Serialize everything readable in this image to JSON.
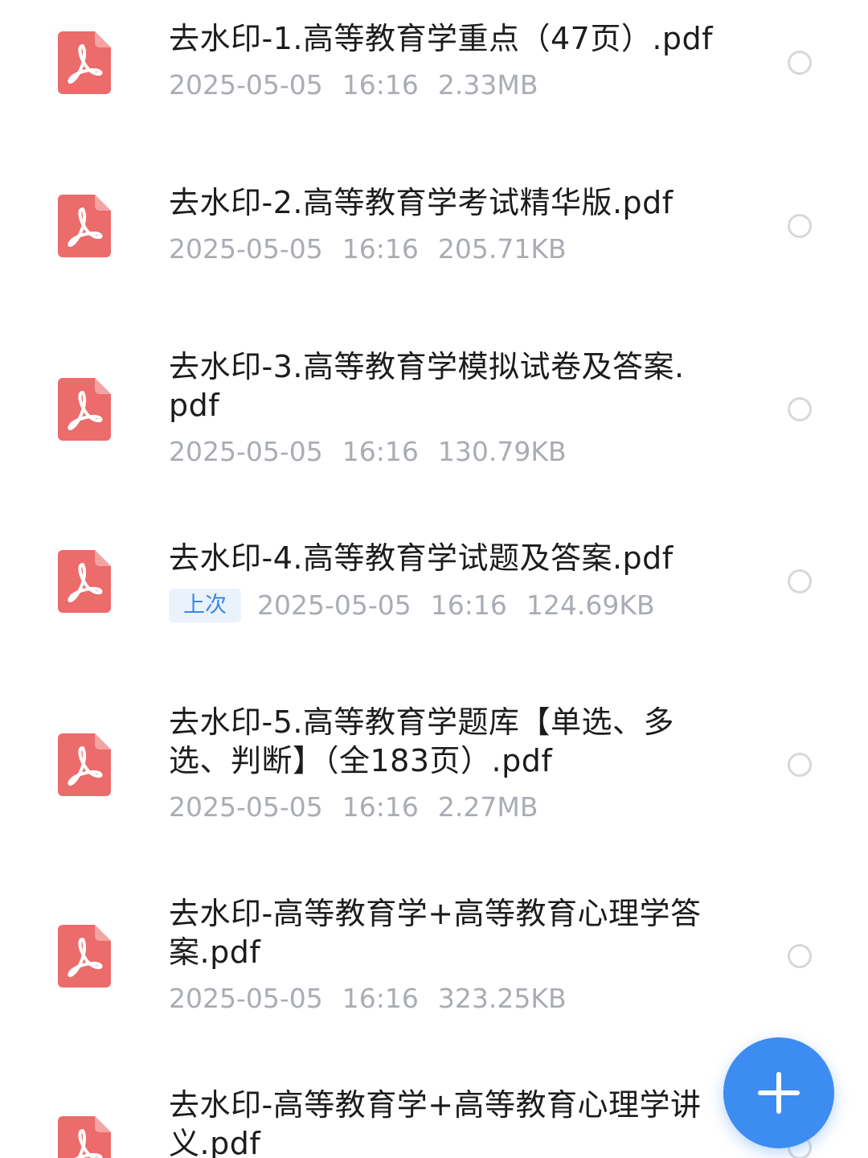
{
  "files": [
    {
      "name": "去水印-1.高等教育学重点（47页）.pdf",
      "date": "2025-05-05",
      "time": "16:16",
      "size": "2.33MB"
    },
    {
      "name": "去水印-2.高等教育学考试精华版.pdf",
      "date": "2025-05-05",
      "time": "16:16",
      "size": "205.71KB"
    },
    {
      "name": "去水印-3.高等教育学模拟试卷及答案.pdf",
      "date": "2025-05-05",
      "time": "16:16",
      "size": "130.79KB"
    },
    {
      "name": "去水印-4.高等教育学试题及答案.pdf",
      "badge": "上次",
      "date": "2025-05-05",
      "time": "16:16",
      "size": "124.69KB"
    },
    {
      "name": "去水印-5.高等教育学题库【单选、多选、判断】（全183页）.pdf",
      "date": "2025-05-05",
      "time": "16:16",
      "size": "2.27MB"
    },
    {
      "name": "去水印-高等教育学+高等教育心理学答案.pdf",
      "date": "2025-05-05",
      "time": "16:16",
      "size": "323.25KB"
    },
    {
      "name": "去水印-高等教育学+高等教育心理学讲义.pdf"
    }
  ],
  "icons": {
    "file": "pdf-file-icon",
    "select": "radio-circle-icon",
    "fab": "plus-icon"
  },
  "colors": {
    "pdf_icon": "#ec6b6b",
    "fab": "#3d8cf1",
    "badge_text": "#3c86e6",
    "badge_bg": "#eaf3fc",
    "meta_text": "#a9adb3"
  }
}
